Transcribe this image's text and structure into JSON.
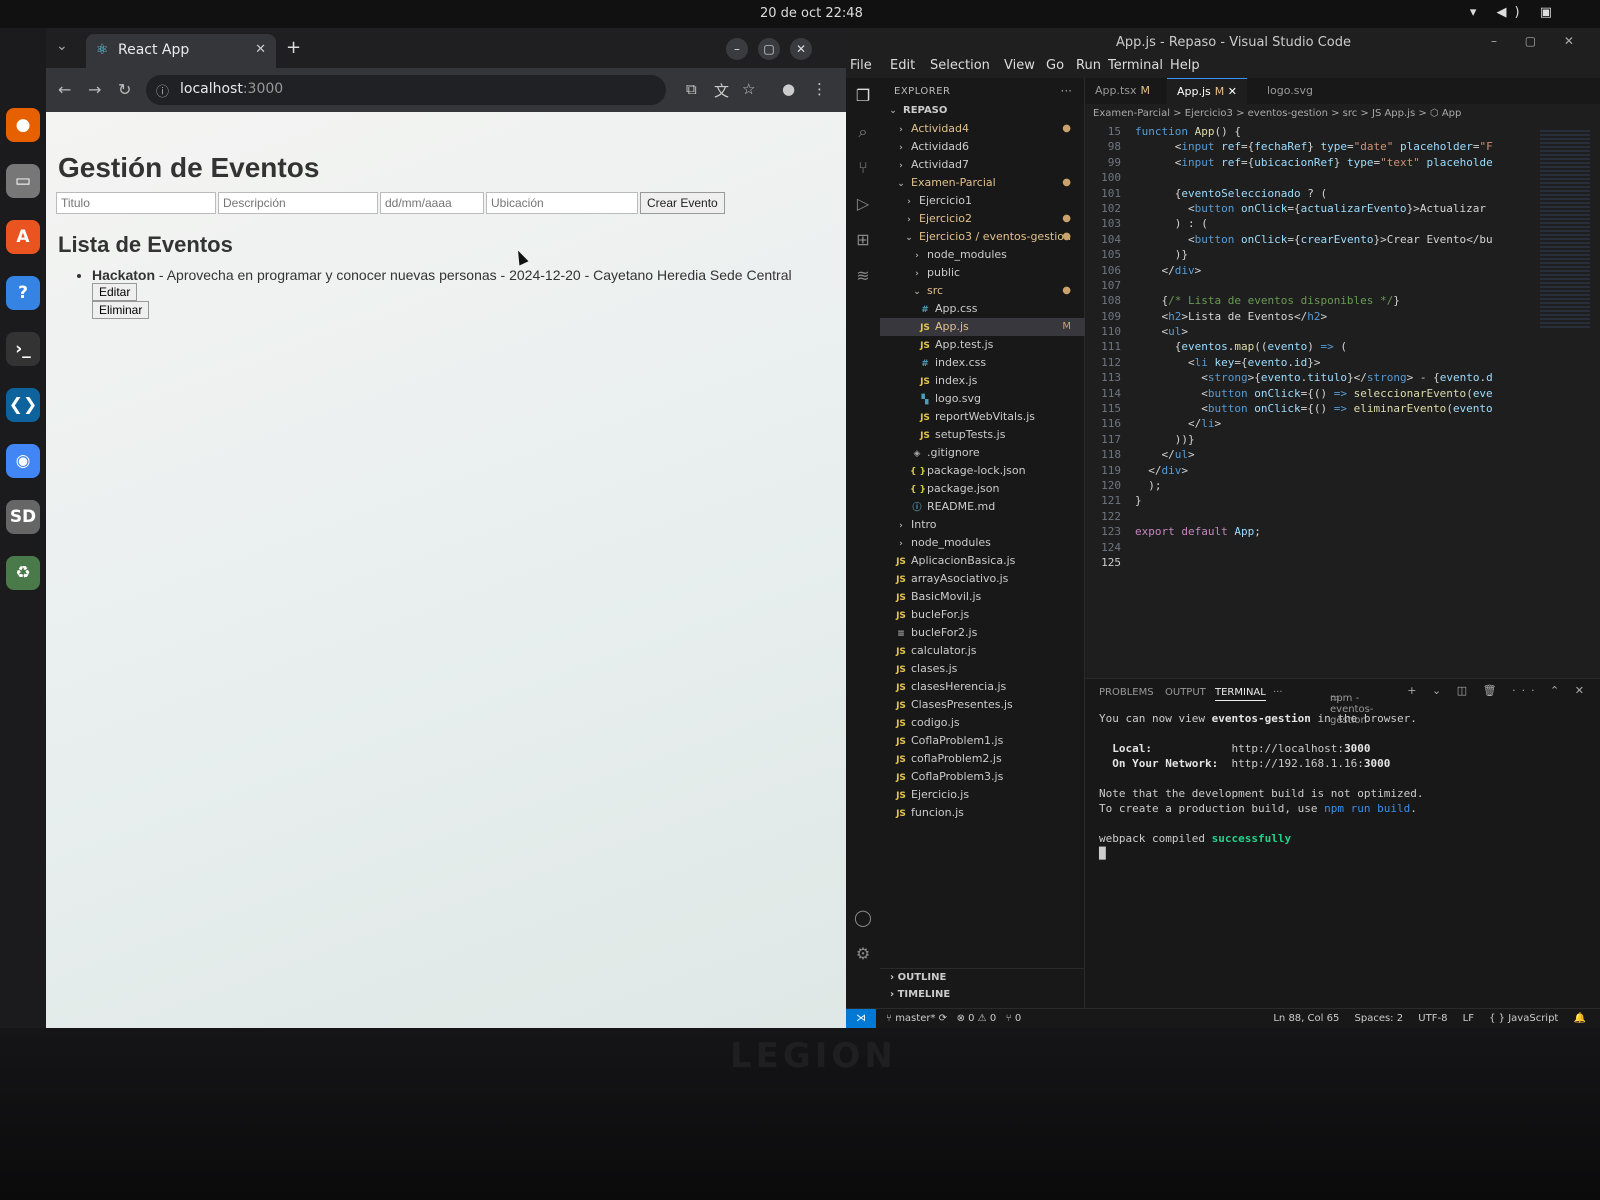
{
  "system": {
    "clock": "20 de oct  22:48"
  },
  "browser": {
    "tab_title": "React App",
    "url_host": "localhost",
    "url_port": ":3000",
    "page": {
      "heading": "Gestión de Eventos",
      "form": {
        "titulo_placeholder": "Titulo",
        "descripcion_placeholder": "Descripción",
        "fecha_placeholder": "dd/mm/aaaa",
        "ubicacion_placeholder": "Ubicación",
        "submit_label": "Crear Evento"
      },
      "list_heading": "Lista de Eventos",
      "events": [
        {
          "titulo": "Hackaton",
          "rest": " - Aprovecha en programar y conocer nuevas personas - 2024-12-20 - Cayetano Heredia Sede Central",
          "edit_label": "Editar",
          "delete_label": "Eliminar"
        }
      ]
    }
  },
  "vscode": {
    "window_title": "App.js - Repaso - Visual Studio Code",
    "menu": [
      "File",
      "Edit",
      "Selection",
      "View",
      "Go",
      "Run",
      "Terminal",
      "Help"
    ],
    "explorer_header": "EXPLORER",
    "root_folder": "REPASO",
    "tree": [
      {
        "label": "Actividad4",
        "type": "folder",
        "depth": 1,
        "dot": true
      },
      {
        "label": "Actividad6",
        "type": "folder",
        "depth": 1
      },
      {
        "label": "Actividad7",
        "type": "folder",
        "depth": 1
      },
      {
        "label": "Examen-Parcial",
        "type": "folder-open",
        "depth": 1,
        "dot": true
      },
      {
        "label": "Ejercicio1",
        "type": "folder",
        "depth": 2
      },
      {
        "label": "Ejercicio2",
        "type": "folder",
        "depth": 2,
        "dot": true
      },
      {
        "label": "Ejercicio3 / eventos-gestion",
        "type": "folder-open",
        "depth": 2,
        "dot": true
      },
      {
        "label": "node_modules",
        "type": "folder",
        "depth": 3
      },
      {
        "label": "public",
        "type": "folder",
        "depth": 3
      },
      {
        "label": "src",
        "type": "folder-open",
        "depth": 3,
        "dot": true
      },
      {
        "label": "App.css",
        "type": "css",
        "depth": 4
      },
      {
        "label": "App.js",
        "type": "js",
        "depth": 4,
        "selected": true,
        "badge": "M"
      },
      {
        "label": "App.test.js",
        "type": "js",
        "depth": 4
      },
      {
        "label": "index.css",
        "type": "css",
        "depth": 4
      },
      {
        "label": "index.js",
        "type": "js",
        "depth": 4
      },
      {
        "label": "logo.svg",
        "type": "svg",
        "depth": 4
      },
      {
        "label": "reportWebVitals.js",
        "type": "js",
        "depth": 4
      },
      {
        "label": "setupTests.js",
        "type": "js",
        "depth": 4
      },
      {
        "label": ".gitignore",
        "type": "git",
        "depth": 3
      },
      {
        "label": "package-lock.json",
        "type": "json",
        "depth": 3
      },
      {
        "label": "package.json",
        "type": "json",
        "depth": 3
      },
      {
        "label": "README.md",
        "type": "info",
        "depth": 3
      },
      {
        "label": "Intro",
        "type": "folder",
        "depth": 1
      },
      {
        "label": "node_modules",
        "type": "folder",
        "depth": 1
      },
      {
        "label": "AplicacionBasica.js",
        "type": "js",
        "depth": 1
      },
      {
        "label": "arrayAsociativo.js",
        "type": "js",
        "depth": 1
      },
      {
        "label": "BasicMovil.js",
        "type": "js",
        "depth": 1
      },
      {
        "label": "bucleFor.js",
        "type": "js",
        "depth": 1
      },
      {
        "label": "bucleFor2.js",
        "type": "txt",
        "depth": 1
      },
      {
        "label": "calculator.js",
        "type": "js",
        "depth": 1
      },
      {
        "label": "clases.js",
        "type": "js",
        "depth": 1
      },
      {
        "label": "clasesHerencia.js",
        "type": "js",
        "depth": 1
      },
      {
        "label": "ClasesPresentes.js",
        "type": "js",
        "depth": 1
      },
      {
        "label": "codigo.js",
        "type": "js",
        "depth": 1
      },
      {
        "label": "CoflaProblem1.js",
        "type": "js",
        "depth": 1
      },
      {
        "label": "coflaProblem2.js",
        "type": "js",
        "depth": 1
      },
      {
        "label": "CoflaProblem3.js",
        "type": "js",
        "depth": 1
      },
      {
        "label": "Ejercicio.js",
        "type": "js",
        "depth": 1
      },
      {
        "label": "funcion.js",
        "type": "js",
        "depth": 1
      }
    ],
    "outline_label": "OUTLINE",
    "timeline_label": "TIMELINE",
    "tabs": [
      {
        "label": "App.tsx",
        "mod": "M",
        "active": false
      },
      {
        "label": "App.js",
        "mod": "M",
        "active": true
      },
      {
        "label": "logo.svg",
        "mod": "",
        "active": false
      }
    ],
    "breadcrumb": "Examen-Parcial > Ejercicio3 > eventos-gestion > src > JS App.js > ⬡ App",
    "code_lines": [
      {
        "n": "15",
        "html": "<span class='t-kw'>function</span> <span class='t-fn'>App</span><span class='t-pun'>() {</span>"
      },
      {
        "n": "98",
        "html": "      <span class='t-pun'>&lt;</span><span class='t-tag'>input</span> <span class='t-attr'>ref</span><span class='t-pun'>={</span><span class='t-var'>fechaRef</span><span class='t-pun'>}</span> <span class='t-attr'>type</span><span class='t-pun'>=</span><span class='t-str'>\"date\"</span> <span class='t-attr'>placeholder</span><span class='t-pun'>=</span><span class='t-str'>\"F</span>"
      },
      {
        "n": "99",
        "html": "      <span class='t-pun'>&lt;</span><span class='t-tag'>input</span> <span class='t-attr'>ref</span><span class='t-pun'>={</span><span class='t-var'>ubicacionRef</span><span class='t-pun'>}</span> <span class='t-attr'>type</span><span class='t-pun'>=</span><span class='t-str'>\"text\"</span> <span class='t-attr'>placeholde</span>"
      },
      {
        "n": "100",
        "html": ""
      },
      {
        "n": "101",
        "html": "      <span class='t-pun'>{</span><span class='t-var'>eventoSeleccionado</span> <span class='t-pun'>? (</span>"
      },
      {
        "n": "102",
        "html": "        <span class='t-pun'>&lt;</span><span class='t-tag'>button</span> <span class='t-attr'>onClick</span><span class='t-pun'>={</span><span class='t-var'>actualizarEvento</span><span class='t-pun'>}&gt;</span><span class='t-txt'>Actualizar </span>"
      },
      {
        "n": "103",
        "html": "      <span class='t-pun'>) : (</span>"
      },
      {
        "n": "104",
        "html": "        <span class='t-pun'>&lt;</span><span class='t-tag'>button</span> <span class='t-attr'>onClick</span><span class='t-pun'>={</span><span class='t-var'>crearEvento</span><span class='t-pun'>}&gt;</span><span class='t-txt'>Crear Evento</span><span class='t-pun'>&lt;/bu</span>"
      },
      {
        "n": "105",
        "html": "      <span class='t-pun'>)}</span>"
      },
      {
        "n": "106",
        "html": "    <span class='t-pun'>&lt;/</span><span class='t-tag'>div</span><span class='t-pun'>&gt;</span>"
      },
      {
        "n": "107",
        "html": ""
      },
      {
        "n": "108",
        "html": "    <span class='t-pun'>{</span><span class='t-cm'>/* Lista de eventos disponibles */</span><span class='t-pun'>}</span>"
      },
      {
        "n": "109",
        "html": "    <span class='t-pun'>&lt;</span><span class='t-tag'>h2</span><span class='t-pun'>&gt;</span><span class='t-txt'>Lista de Eventos</span><span class='t-pun'>&lt;/</span><span class='t-tag'>h2</span><span class='t-pun'>&gt;</span>"
      },
      {
        "n": "110",
        "html": "    <span class='t-pun'>&lt;</span><span class='t-tag'>ul</span><span class='t-pun'>&gt;</span>"
      },
      {
        "n": "111",
        "html": "      <span class='t-pun'>{</span><span class='t-var'>eventos</span><span class='t-pun'>.</span><span class='t-fn'>map</span><span class='t-pun'>((</span><span class='t-var'>evento</span><span class='t-pun'>) </span><span class='t-kw'>=&gt;</span><span class='t-pun'> (</span>"
      },
      {
        "n": "112",
        "html": "        <span class='t-pun'>&lt;</span><span class='t-tag'>li</span> <span class='t-attr'>key</span><span class='t-pun'>={</span><span class='t-var'>evento</span><span class='t-pun'>.</span><span class='t-var'>id</span><span class='t-pun'>}&gt;</span>"
      },
      {
        "n": "113",
        "html": "          <span class='t-pun'>&lt;</span><span class='t-tag'>strong</span><span class='t-pun'>&gt;{</span><span class='t-var'>evento</span><span class='t-pun'>.</span><span class='t-var'>titulo</span><span class='t-pun'>}&lt;/</span><span class='t-tag'>strong</span><span class='t-pun'>&gt;</span> <span class='t-txt'>-</span> <span class='t-pun'>{</span><span class='t-var'>evento</span><span class='t-pun'>.</span><span class='t-var'>d</span>"
      },
      {
        "n": "114",
        "html": "          <span class='t-pun'>&lt;</span><span class='t-tag'>button</span> <span class='t-attr'>onClick</span><span class='t-pun'>={() </span><span class='t-kw'>=&gt;</span> <span class='t-fn'>seleccionarEvento</span><span class='t-pun'>(</span><span class='t-var'>eve</span>"
      },
      {
        "n": "115",
        "html": "          <span class='t-pun'>&lt;</span><span class='t-tag'>button</span> <span class='t-attr'>onClick</span><span class='t-pun'>={() </span><span class='t-kw'>=&gt;</span> <span class='t-fn'>eliminarEvento</span><span class='t-pun'>(</span><span class='t-var'>evento</span>"
      },
      {
        "n": "116",
        "html": "        <span class='t-pun'>&lt;/</span><span class='t-tag'>li</span><span class='t-pun'>&gt;</span>"
      },
      {
        "n": "117",
        "html": "      <span class='t-pun'>))}</span>"
      },
      {
        "n": "118",
        "html": "    <span class='t-pun'>&lt;/</span><span class='t-tag'>ul</span><span class='t-pun'>&gt;</span>"
      },
      {
        "n": "119",
        "html": "  <span class='t-pun'>&lt;/</span><span class='t-tag'>div</span><span class='t-pun'>&gt;</span>"
      },
      {
        "n": "120",
        "html": "  <span class='t-pun'>);</span>"
      },
      {
        "n": "121",
        "html": "<span class='t-pun'>}</span>"
      },
      {
        "n": "122",
        "html": ""
      },
      {
        "n": "123",
        "html": "<span class='t-ctl'>export</span> <span class='t-ctl'>default</span> <span class='t-var'>App</span><span class='t-pun'>;</span>"
      },
      {
        "n": "124",
        "html": ""
      },
      {
        "n": "125",
        "html": ""
      }
    ],
    "panel_tabs": [
      "PROBLEMS",
      "OUTPUT",
      "TERMINAL"
    ],
    "panel_active": "TERMINAL",
    "terminal_process": "npm - eventos-gestion",
    "terminal_lines": [
      "You can now view <span class='b'>eventos-gestion</span> in the browser.",
      "",
      "  <span class='b'>Local:</span>            http://localhost:<span class='b'>3000</span>",
      "  <span class='b'>On Your Network:</span>  http://192.168.1.16:<span class='b'>3000</span>",
      "",
      "Note that the development build is not optimized.",
      "To create a production build, use <span class='cy'>npm run build</span>.",
      "",
      "webpack compiled <span class='gr'>successfully</span>",
      "█"
    ],
    "status": {
      "branch": "master*",
      "problems": "⊗ 0 ⚠ 0",
      "ports": "⑂ 0",
      "position": "Ln 88, Col 65",
      "spaces": "Spaces: 2",
      "encoding": "UTF-8",
      "eol": "LF",
      "language": "{ } JavaScript"
    }
  },
  "laptop_brand": "LEGION"
}
